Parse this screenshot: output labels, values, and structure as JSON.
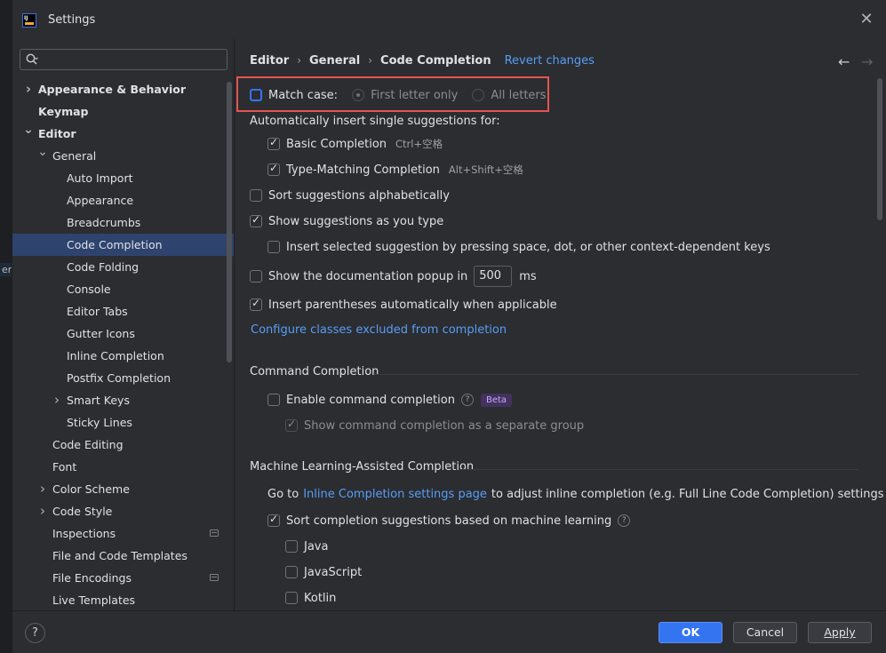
{
  "window": {
    "title": "Settings",
    "app_logo_text": "IJ"
  },
  "background_fragment": "er",
  "search": {
    "placeholder": "",
    "value": ""
  },
  "tree": [
    {
      "label": "Appearance & Behavior",
      "level": 0,
      "bold": true,
      "chevron": "right"
    },
    {
      "label": "Keymap",
      "level": 0,
      "bold": true,
      "chevron": ""
    },
    {
      "label": "Editor",
      "level": 0,
      "bold": true,
      "chevron": "down"
    },
    {
      "label": "General",
      "level": 1,
      "bold": false,
      "chevron": "down"
    },
    {
      "label": "Auto Import",
      "level": 2,
      "bold": false,
      "chevron": ""
    },
    {
      "label": "Appearance",
      "level": 2,
      "bold": false,
      "chevron": ""
    },
    {
      "label": "Breadcrumbs",
      "level": 2,
      "bold": false,
      "chevron": ""
    },
    {
      "label": "Code Completion",
      "level": 2,
      "bold": false,
      "chevron": "",
      "selected": true
    },
    {
      "label": "Code Folding",
      "level": 2,
      "bold": false,
      "chevron": ""
    },
    {
      "label": "Console",
      "level": 2,
      "bold": false,
      "chevron": ""
    },
    {
      "label": "Editor Tabs",
      "level": 2,
      "bold": false,
      "chevron": ""
    },
    {
      "label": "Gutter Icons",
      "level": 2,
      "bold": false,
      "chevron": ""
    },
    {
      "label": "Inline Completion",
      "level": 2,
      "bold": false,
      "chevron": ""
    },
    {
      "label": "Postfix Completion",
      "level": 2,
      "bold": false,
      "chevron": ""
    },
    {
      "label": "Smart Keys",
      "level": 2,
      "bold": false,
      "chevron": "right"
    },
    {
      "label": "Sticky Lines",
      "level": 2,
      "bold": false,
      "chevron": ""
    },
    {
      "label": "Code Editing",
      "level": 1,
      "bold": false,
      "chevron": ""
    },
    {
      "label": "Font",
      "level": 1,
      "bold": false,
      "chevron": ""
    },
    {
      "label": "Color Scheme",
      "level": 1,
      "bold": false,
      "chevron": "right"
    },
    {
      "label": "Code Style",
      "level": 1,
      "bold": false,
      "chevron": "right"
    },
    {
      "label": "Inspections",
      "level": 1,
      "bold": false,
      "chevron": "",
      "project_icon": true
    },
    {
      "label": "File and Code Templates",
      "level": 1,
      "bold": false,
      "chevron": ""
    },
    {
      "label": "File Encodings",
      "level": 1,
      "bold": false,
      "chevron": "",
      "project_icon": true
    },
    {
      "label": "Live Templates",
      "level": 1,
      "bold": false,
      "chevron": ""
    }
  ],
  "breadcrumb": {
    "items": [
      "Editor",
      "General",
      "Code Completion"
    ],
    "revert": "Revert changes"
  },
  "options": {
    "match_case": {
      "label": "Match case:",
      "checked": false
    },
    "radio_first": "First letter only",
    "radio_all": "All letters",
    "auto_insert_header": "Automatically insert single suggestions for:",
    "basic": {
      "label": "Basic Completion",
      "shortcut": "Ctrl+空格",
      "checked": true
    },
    "type_matching": {
      "label": "Type-Matching Completion",
      "shortcut": "Alt+Shift+空格",
      "checked": true
    },
    "sort_alpha": "Sort suggestions alphabetically",
    "show_as_type": "Show suggestions as you type",
    "insert_selected": "Insert selected suggestion by pressing space, dot, or other context-dependent keys",
    "doc_popup": {
      "label": "Show the documentation popup in",
      "value": "500",
      "unit": "ms"
    },
    "insert_parens": "Insert parentheses automatically when applicable",
    "configure_link": "Configure classes excluded from completion"
  },
  "command_completion": {
    "title": "Command Completion",
    "enable": "Enable command completion",
    "help": "?",
    "beta": "Beta",
    "separate_group": "Show command completion as a separate group"
  },
  "ml_completion": {
    "title": "Machine Learning-Assisted Completion",
    "goto_prefix": "Go to",
    "goto_link": "Inline Completion settings page",
    "goto_suffix": "to adjust inline completion (e.g. Full Line Code Completion) settings",
    "sort_ml": "Sort completion suggestions based on machine learning",
    "help": "?",
    "languages": [
      "Java",
      "JavaScript",
      "Kotlin"
    ]
  },
  "footer": {
    "help": "?",
    "ok": "OK",
    "cancel": "Cancel",
    "apply": "Apply"
  },
  "colors": {
    "accent": "#3574f0",
    "selected_row": "#2e436e",
    "link": "#589df6",
    "highlight": "#e55353"
  }
}
